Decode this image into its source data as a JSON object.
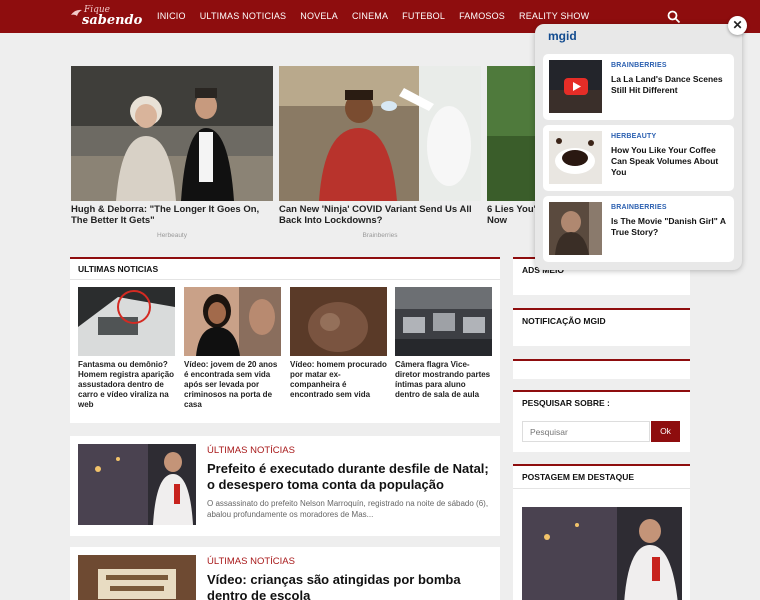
{
  "header": {
    "logo_top": "Fique",
    "logo_bottom": "sabendo",
    "nav": [
      "INICIO",
      "ULTIMAS NOTICIAS",
      "NOVELA",
      "CINEMA",
      "FUTEBOL",
      "FAMOSOS",
      "REALITY SHOW"
    ],
    "search_icon": "search-icon",
    "colors": {
      "brand": "#8e0d0e"
    }
  },
  "recommendations": [
    {
      "title": "Hugh & Deborra: \"The Longer It Goes On, The Better It Gets\"",
      "source": "Herbeauty"
    },
    {
      "title": "Can New 'Ninja' COVID Variant Send Us All Back Into Lockdowns?",
      "source": "Brainberries"
    },
    {
      "title": "6 Lies You'S Now",
      "source": ""
    }
  ],
  "ultimas": {
    "title": "ULTIMAS NOTICIAS",
    "cards": [
      {
        "title": "Fantasma ou demônio? Homem registra aparição assustadora dentro de carro e vídeo viraliza na web"
      },
      {
        "title": "Vídeo: jovem de 20 anos é encontrada sem vida após ser levada por criminosos na porta de casa"
      },
      {
        "title": "Vídeo: homem procurado por matar ex-companheira é encontrado sem vida"
      },
      {
        "title": "Câmera flagra Vice-diretor mostrando partes íntimas para aluno dentro de sala de aula"
      }
    ]
  },
  "articles": [
    {
      "category": "ÚLTIMAS NOTÍCIAS",
      "headline": "Prefeito é executado durante desfile de Natal; o desespero toma conta da população",
      "excerpt": "O assassinato do prefeito Nelson Marroquín, registrado na noite de sábado (6), abalou profundamente os moradores de Mas..."
    },
    {
      "category": "ÚLTIMAS NOTÍCIAS",
      "headline": "Vídeo: crianças são atingidas por bomba dentro de escola",
      "excerpt": ""
    }
  ],
  "sidebar": {
    "ads_title": "ADS MEIO",
    "mgid_title": "NOTIFICAÇÃO MGID",
    "search_title": "PESQUISAR SOBRE :",
    "search_placeholder": "Pesquisar",
    "search_button": "Ok",
    "featured_title": "POSTAGEM EM DESTAQUE"
  },
  "popup": {
    "brand": "mgid",
    "close": "✕",
    "items": [
      {
        "source": "BRAINBERRIES",
        "title": "La La Land's Dance Scenes Still Hit Different"
      },
      {
        "source": "HERBEAUTY",
        "title": "How You Like Your Coffee Can Speak Volumes About You"
      },
      {
        "source": "BRAINBERRIES",
        "title": "Is The Movie \"Danish Girl\" A True Story?"
      }
    ]
  }
}
